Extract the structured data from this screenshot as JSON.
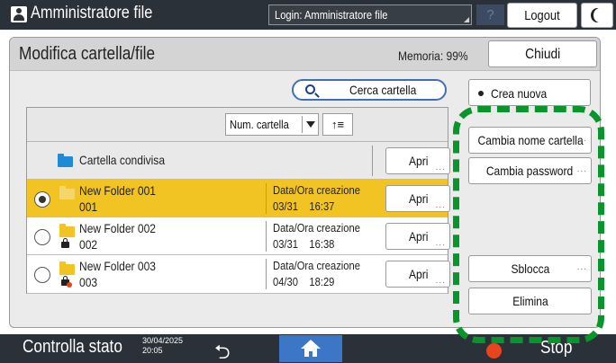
{
  "top_bar": {
    "app_title": "Amministratore file",
    "login_label": "Login: Amministratore file",
    "help_label": "?",
    "logout_label": "Logout"
  },
  "window": {
    "title": "Modifica cartella/file",
    "memory_label": "Memoria:",
    "memory_value": "99%",
    "close_label": "Chiudi"
  },
  "search": {
    "label": "Cerca cartella"
  },
  "sort": {
    "field": "Num. cartella",
    "order_symbol": "↑≡"
  },
  "shared_folder": {
    "name": "Cartella condivisa",
    "open_label": "Apri"
  },
  "folders": [
    {
      "name": "New Folder 001",
      "number": "001",
      "date_label": "Data/Ora creazione",
      "date": "03/31",
      "time": "16:37",
      "open_label": "Apri",
      "selected": true,
      "locked": false,
      "lock_blocked": false
    },
    {
      "name": "New Folder 002",
      "number": "002",
      "date_label": "Data/Ora creazione",
      "date": "03/31",
      "time": "16:38",
      "open_label": "Apri",
      "selected": false,
      "locked": true,
      "lock_blocked": false
    },
    {
      "name": "New Folder 003",
      "number": "003",
      "date_label": "Data/Ora creazione",
      "date": "04/30",
      "time": "18:29",
      "open_label": "Apri",
      "selected": false,
      "locked": true,
      "lock_blocked": true
    }
  ],
  "side_actions": {
    "create_new": "Crea nuova",
    "rename": "Cambia nome cartella",
    "change_password": "Cambia password",
    "unlock": "Sblocca",
    "delete": "Elimina"
  },
  "bottom_bar": {
    "status_label": "Controlla stato",
    "date": "30/04/2025",
    "time": "20:05",
    "stop_label": "Stop"
  },
  "colors": {
    "selected_row": "#f2c423",
    "highlight_dash": "#08962c",
    "home_button": "#3b76c7",
    "top_bar": "#2b3138",
    "folder_shared": "#1f8bd6",
    "folder_yellow": "#f2c423"
  },
  "icons": [
    "user-icon",
    "moon-icon",
    "search-icon",
    "folder-icon",
    "lock-icon",
    "back-icon",
    "home-icon",
    "stop-icon"
  ]
}
